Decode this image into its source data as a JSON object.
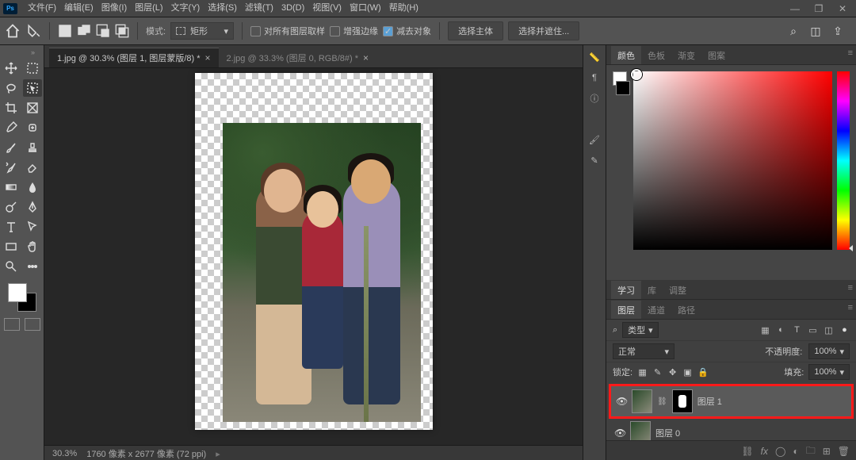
{
  "menu": {
    "file": "文件(F)",
    "edit": "编辑(E)",
    "image": "图像(I)",
    "layer": "图层(L)",
    "type": "文字(Y)",
    "select": "选择(S)",
    "filter": "滤镜(T)",
    "threed": "3D(D)",
    "view": "视图(V)",
    "window": "窗口(W)",
    "help": "帮助(H)"
  },
  "optbar": {
    "mode": "模式:",
    "shape": "矩形",
    "allLayers": "对所有图层取样",
    "enhanceEdge": "增强边缘",
    "subtractObj": "减去对象",
    "selectSubject": "选择主体",
    "selectAndMask": "选择并遮住..."
  },
  "tabs": {
    "t1": "1.jpg @ 30.3% (图层 1, 图层蒙版/8) *",
    "t2": "2.jpg @ 33.3% (图层 0, RGB/8#) *"
  },
  "status": {
    "zoom": "30.3%",
    "dim": "1760 像素 x 2677 像素 (72 ppi)"
  },
  "colorPanel": {
    "color": "颜色",
    "swatch": "色板",
    "grad": "渐变",
    "pattern": "图案"
  },
  "sec2": {
    "learn": "学习",
    "lib": "库",
    "adjust": "调整"
  },
  "layerPanel": {
    "layers": "图层",
    "channels": "通道",
    "paths": "路径",
    "kindLabel": "类型",
    "blend": "正常",
    "opLabel": "不透明度:",
    "opVal": "100%",
    "lockLabel": "锁定:",
    "fillLabel": "填充:",
    "fillVal": "100%"
  },
  "layers": {
    "l1": "图层 1",
    "l0": "图层 0"
  }
}
